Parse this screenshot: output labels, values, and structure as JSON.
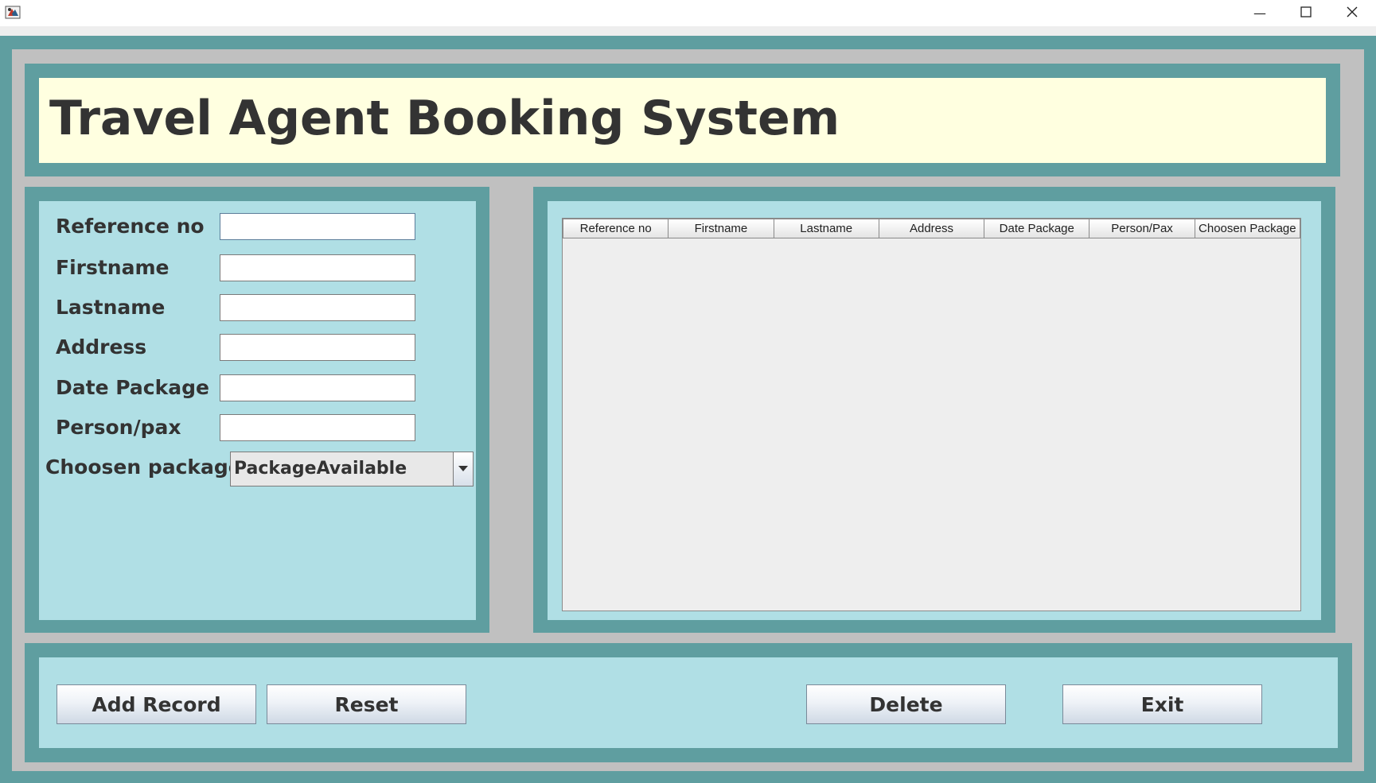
{
  "window": {
    "minimize_glyph": "—",
    "maximize_glyph": "☐",
    "close_glyph": "✕"
  },
  "header": {
    "title": "Travel Agent Booking System"
  },
  "form": {
    "fields": [
      {
        "label": "Reference no",
        "value": ""
      },
      {
        "label": "Firstname",
        "value": ""
      },
      {
        "label": "Lastname",
        "value": ""
      },
      {
        "label": "Address",
        "value": ""
      },
      {
        "label": "Date Package",
        "value": ""
      },
      {
        "label": "Person/pax",
        "value": ""
      }
    ],
    "package_label": "Choosen package",
    "package_selected": "PackageAvailable"
  },
  "table": {
    "columns": [
      "Reference no",
      "Firstname",
      "Lastname",
      "Address",
      "Date Package",
      "Person/Pax",
      "Choosen Package"
    ],
    "rows": []
  },
  "buttons": {
    "add": "Add Record",
    "reset": "Reset",
    "delete": "Delete",
    "exit": "Exit"
  },
  "colors": {
    "frame": "#5f9ea0",
    "panel": "#b0dfe5",
    "title_bg": "#ffffe0",
    "gap": "#c0c0c0"
  },
  "icons": [
    "java-app-icon",
    "minimize-icon",
    "maximize-icon",
    "close-icon",
    "dropdown-arrow-icon"
  ]
}
